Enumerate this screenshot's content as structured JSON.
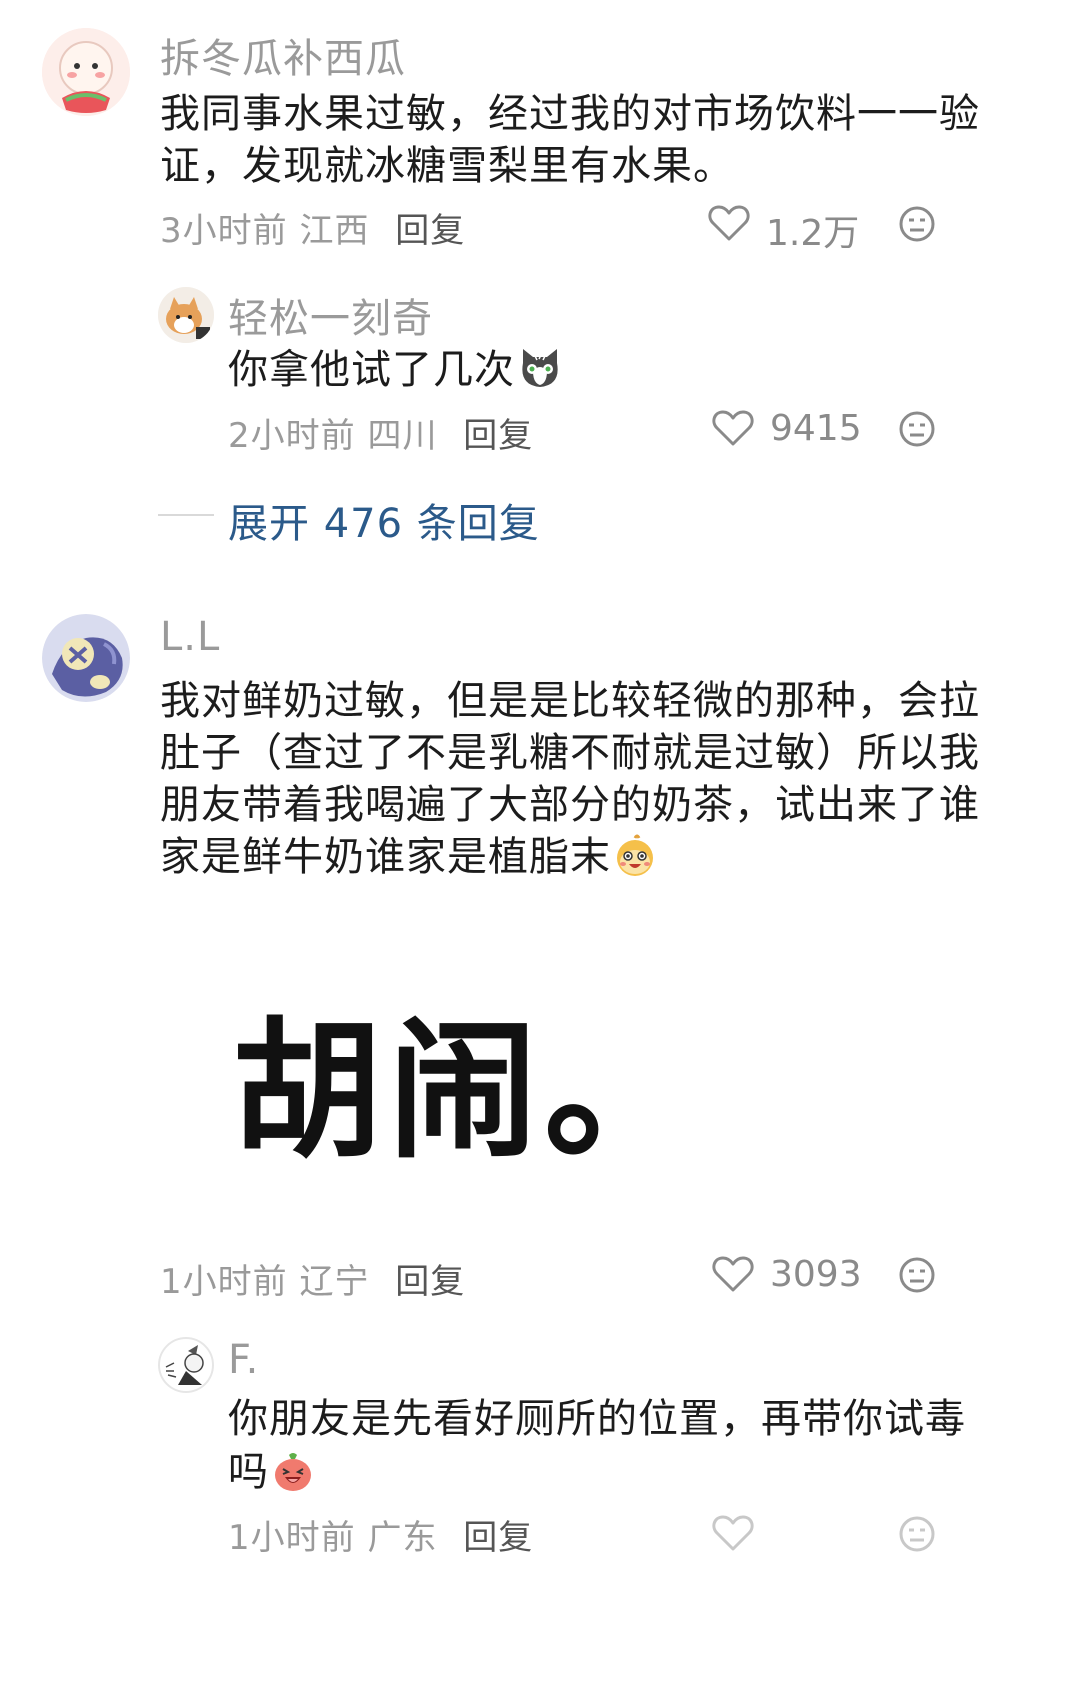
{
  "comments": [
    {
      "username": "拆冬瓜补西瓜",
      "text_line1": "我同事水果过敏，经过我的对市场饮料一一验",
      "text_line2": "证，发现就冰糖雪梨里有水果。",
      "time": "3小时前",
      "location": "江西",
      "reply_label": "回复",
      "likes": "1.2万",
      "replies": [
        {
          "username": "轻松一刻奇",
          "text": "你拿他试了几次",
          "time": "2小时前",
          "location": "四川",
          "reply_label": "回复",
          "likes": "9415"
        }
      ],
      "expand_label": "展开 476 条回复"
    },
    {
      "username": "L.L",
      "text_line1": "我对鲜奶过敏，但是是比较轻微的那种，会拉",
      "text_line2": "肚子（查过了不是乳糖不耐就是过敏）所以我",
      "text_line3": "朋友带着我喝遍了大部分的奶茶，试出来了谁",
      "text_line4": "家是鲜牛奶谁家是植脂末",
      "image_text": "胡闹。",
      "time": "1小时前",
      "location": "辽宁",
      "reply_label": "回复",
      "likes": "3093",
      "replies": [
        {
          "username": "F.",
          "text_line1": "你朋友是先看好厕所的位置，再带你试毒",
          "text_line2": "吗",
          "time": "1小时前",
          "location": "广东",
          "reply_label": "回复"
        }
      ]
    }
  ],
  "icons": {
    "like": "heart-outline-icon",
    "react": "neutral-face-icon"
  },
  "colors": {
    "link": "#2b5a8a",
    "meta": "#9a9a9a"
  }
}
